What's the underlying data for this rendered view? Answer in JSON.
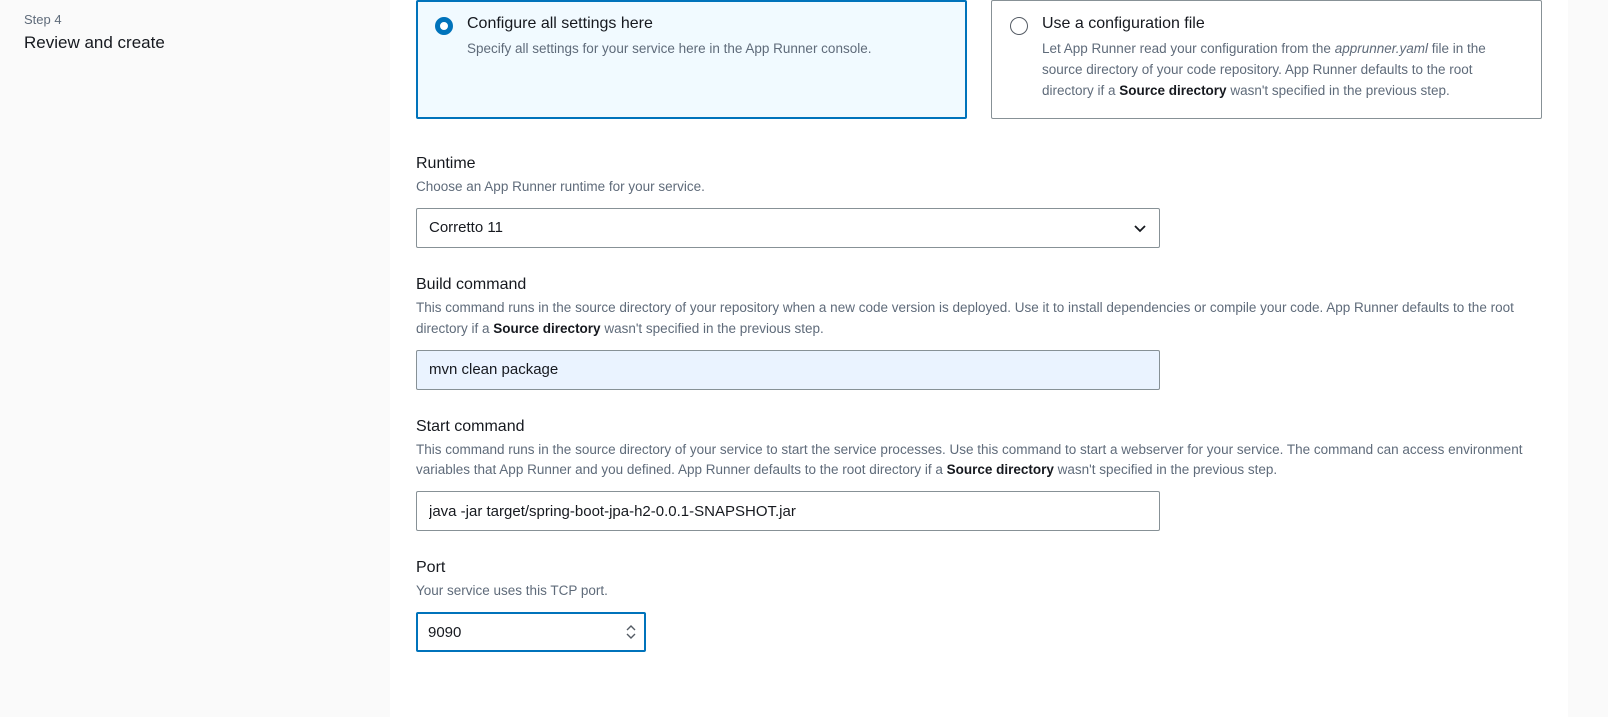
{
  "sidebar": {
    "step_label": "Step 4",
    "step_title": "Review and create"
  },
  "options": {
    "configure_here": {
      "title": "Configure all settings here",
      "desc": "Specify all settings for your service here in the App Runner console."
    },
    "use_config_file": {
      "title": "Use a configuration file",
      "desc_prefix": "Let App Runner read your configuration from the ",
      "desc_filename": "apprunner.yaml",
      "desc_mid": " file in the source directory of your code repository. App Runner defaults to the root directory if a ",
      "desc_bold": "Source directory",
      "desc_suffix": " wasn't specified in the previous step."
    }
  },
  "runtime": {
    "label": "Runtime",
    "help": "Choose an App Runner runtime for your service.",
    "value": "Corretto 11"
  },
  "build_command": {
    "label": "Build command",
    "help_prefix": "This command runs in the source directory of your repository when a new code version is deployed. Use it to install dependencies or compile your code. App Runner defaults to the root directory if a ",
    "help_bold": "Source directory",
    "help_suffix": " wasn't specified in the previous step.",
    "value": "mvn clean package"
  },
  "start_command": {
    "label": "Start command",
    "help_prefix": "This command runs in the source directory of your service to start the service processes. Use this command to start a webserver for your service. The command can access environment variables that App Runner and you defined. App Runner defaults to the root directory if a ",
    "help_bold": "Source directory",
    "help_suffix": " wasn't specified in the previous step.",
    "value": "java -jar target/spring-boot-jpa-h2-0.0.1-SNAPSHOT.jar"
  },
  "port": {
    "label": "Port",
    "help": "Your service uses this TCP port.",
    "value": "9090"
  }
}
